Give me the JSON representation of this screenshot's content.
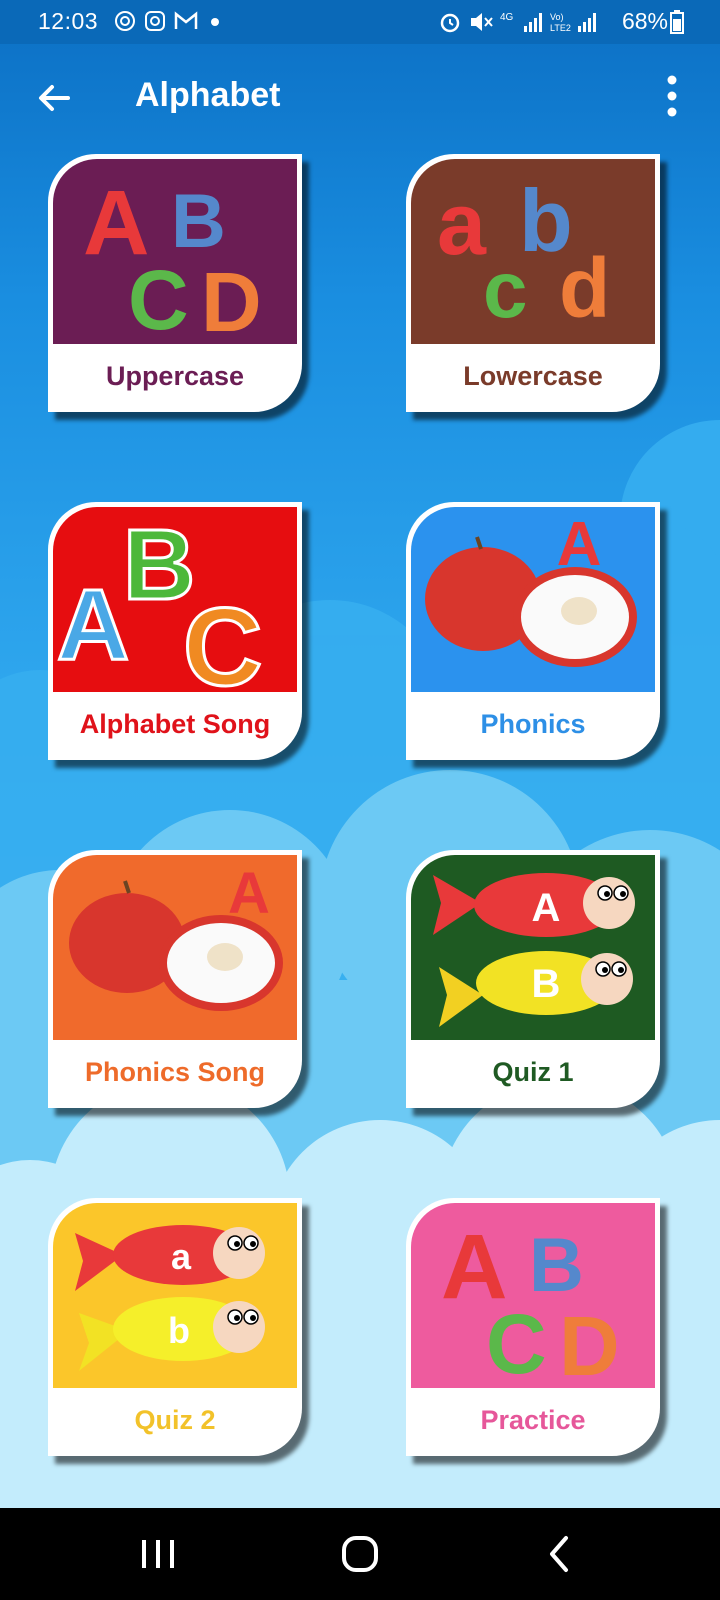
{
  "status_bar": {
    "time": "12:03",
    "battery": "68%"
  },
  "app_bar": {
    "title": "Alphabet"
  },
  "cards": [
    {
      "label": "Uppercase",
      "color": "#6b1d54",
      "bg": "#6b1d54",
      "art_letters": [
        "A",
        "B",
        "C",
        "D"
      ]
    },
    {
      "label": "Lowercase",
      "color": "#7a3b2a",
      "bg": "#7a3b2a",
      "art_letters": [
        "a",
        "b",
        "c",
        "d"
      ]
    },
    {
      "label": "Alphabet Song",
      "color": "#e0121a",
      "bg": "#e60d10",
      "art_letters": [
        "A",
        "B",
        "C"
      ]
    },
    {
      "label": "Phonics",
      "color": "#2d8fe6",
      "bg": "#2b92ee",
      "art_letters": [
        "A"
      ]
    },
    {
      "label": "Phonics Song",
      "color": "#ee6b2a",
      "bg": "#f06a2c",
      "art_letters": [
        "A"
      ]
    },
    {
      "label": "Quiz 1",
      "color": "#1f5a23",
      "bg": "#1e5a22",
      "art_letters": [
        "A",
        "B"
      ]
    },
    {
      "label": "Quiz 2",
      "color": "#f2c22a",
      "bg": "#fbc62a",
      "art_letters": [
        "a",
        "b"
      ]
    },
    {
      "label": "Practice",
      "color": "#e6579a",
      "bg": "#ee5b9e",
      "art_letters": [
        "A",
        "B",
        "C",
        "D"
      ]
    }
  ],
  "icons": {
    "back": "arrow-left-icon",
    "more": "more-vertical-icon",
    "nav_recents": "recents-icon",
    "nav_home": "home-icon",
    "nav_back": "nav-back-icon"
  }
}
